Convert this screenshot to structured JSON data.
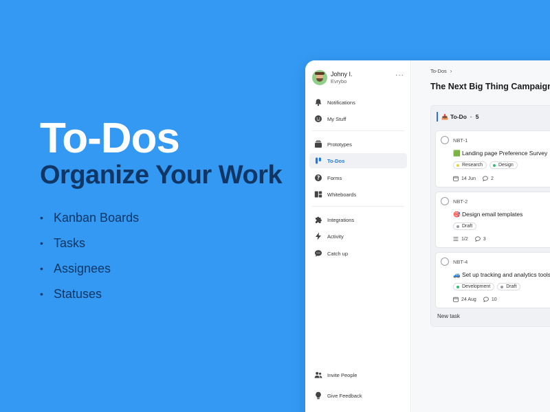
{
  "hero": {
    "title": "To-Dos",
    "subtitle": "Organize Your Work",
    "features": [
      "Kanban Boards",
      "Tasks",
      "Assignees",
      "Statuses"
    ]
  },
  "user": {
    "name": "Johny I.",
    "org": "Evrybo",
    "more": "···"
  },
  "sidebar": {
    "items": [
      {
        "label": "Notifications",
        "icon": "bell-icon"
      },
      {
        "label": "My Stuff",
        "icon": "smiley-icon"
      },
      {
        "label": "Prototypes",
        "icon": "layers-icon"
      },
      {
        "label": "To-Dos",
        "icon": "board-icon",
        "active": true
      },
      {
        "label": "Forms",
        "icon": "question-icon"
      },
      {
        "label": "Whiteboards",
        "icon": "whiteboard-icon"
      },
      {
        "label": "Integrations",
        "icon": "puzzle-icon"
      },
      {
        "label": "Activity",
        "icon": "bolt-icon"
      },
      {
        "label": "Catch up",
        "icon": "chat-icon"
      }
    ],
    "bottom": [
      {
        "label": "Invite People",
        "icon": "people-icon"
      },
      {
        "label": "Give Feedback",
        "icon": "lightbulb-icon"
      }
    ]
  },
  "main": {
    "breadcrumb": "To-Dos",
    "breadcrumb_chevron": "›",
    "title": "The Next Big Thing Campaign"
  },
  "column": {
    "title": "To-Do",
    "emoji": "📥",
    "separator": "·",
    "count": "5",
    "new_task": "New task",
    "accent": "#2f6fdc"
  },
  "cards": [
    {
      "id": "NBT-1",
      "emoji": "🟩",
      "title": "Landing page Preference Survey",
      "priority": "︽",
      "priority_color": "#e0532f",
      "tags": [
        {
          "label": "Research",
          "color": "#e5d33a"
        },
        {
          "label": "Design",
          "color": "#2fbf71"
        }
      ],
      "date": "14 Jun",
      "comments": "2"
    },
    {
      "id": "NBT-2",
      "emoji": "🎯",
      "title": "Design email templates",
      "priority": "=",
      "priority_color": "#2f6fdc",
      "tags": [
        {
          "label": "Draft",
          "color": "#9a9ca3"
        }
      ],
      "subtasks": "1/2",
      "comments": "3"
    },
    {
      "id": "NBT-4",
      "emoji": "🚙",
      "title": "Set up tracking and analytics tools",
      "priority": "︽",
      "priority_color": "#e0532f",
      "tags": [
        {
          "label": "Development",
          "color": "#2fbf71"
        },
        {
          "label": "Draft",
          "color": "#9a9ca3"
        }
      ],
      "date": "24 Aug",
      "comments": "10"
    }
  ]
}
